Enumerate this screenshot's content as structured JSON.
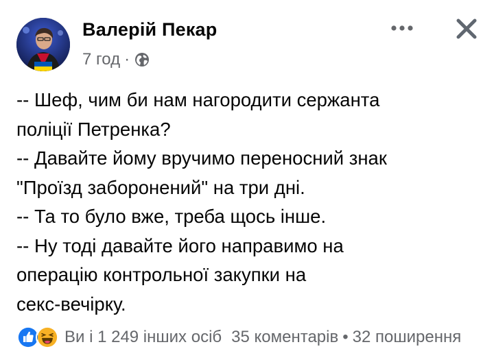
{
  "post": {
    "author": "Валерій Пекар",
    "time": "7 год",
    "separator": "·",
    "audience_icon": "globe-icon",
    "body_lines": [
      "-- Шеф, чим би нам нагородити сержанта",
      "поліції Петренка?",
      "-- Давайте йому вручимо переносний знак",
      "\"Проїзд заборонений\" на три дні.",
      "-- Та то було вже, треба щось інше.",
      "-- Ну тоді давайте його направимо на",
      "операцію контрольної закупки на",
      "секс-вечірку."
    ]
  },
  "header": {
    "more_icon": "more-icon",
    "close_icon": "close-icon"
  },
  "footer": {
    "reaction_icons": [
      "like-icon",
      "haha-icon"
    ],
    "reactions_text": "Ви і 1 249 інших осіб",
    "comments": "35 коментарів",
    "dot": "•",
    "shares": "32 поширення"
  },
  "colors": {
    "text": "#050505",
    "secondary": "#65676b",
    "like_blue": "#1877f2",
    "haha_yellow": "#f7b125"
  }
}
